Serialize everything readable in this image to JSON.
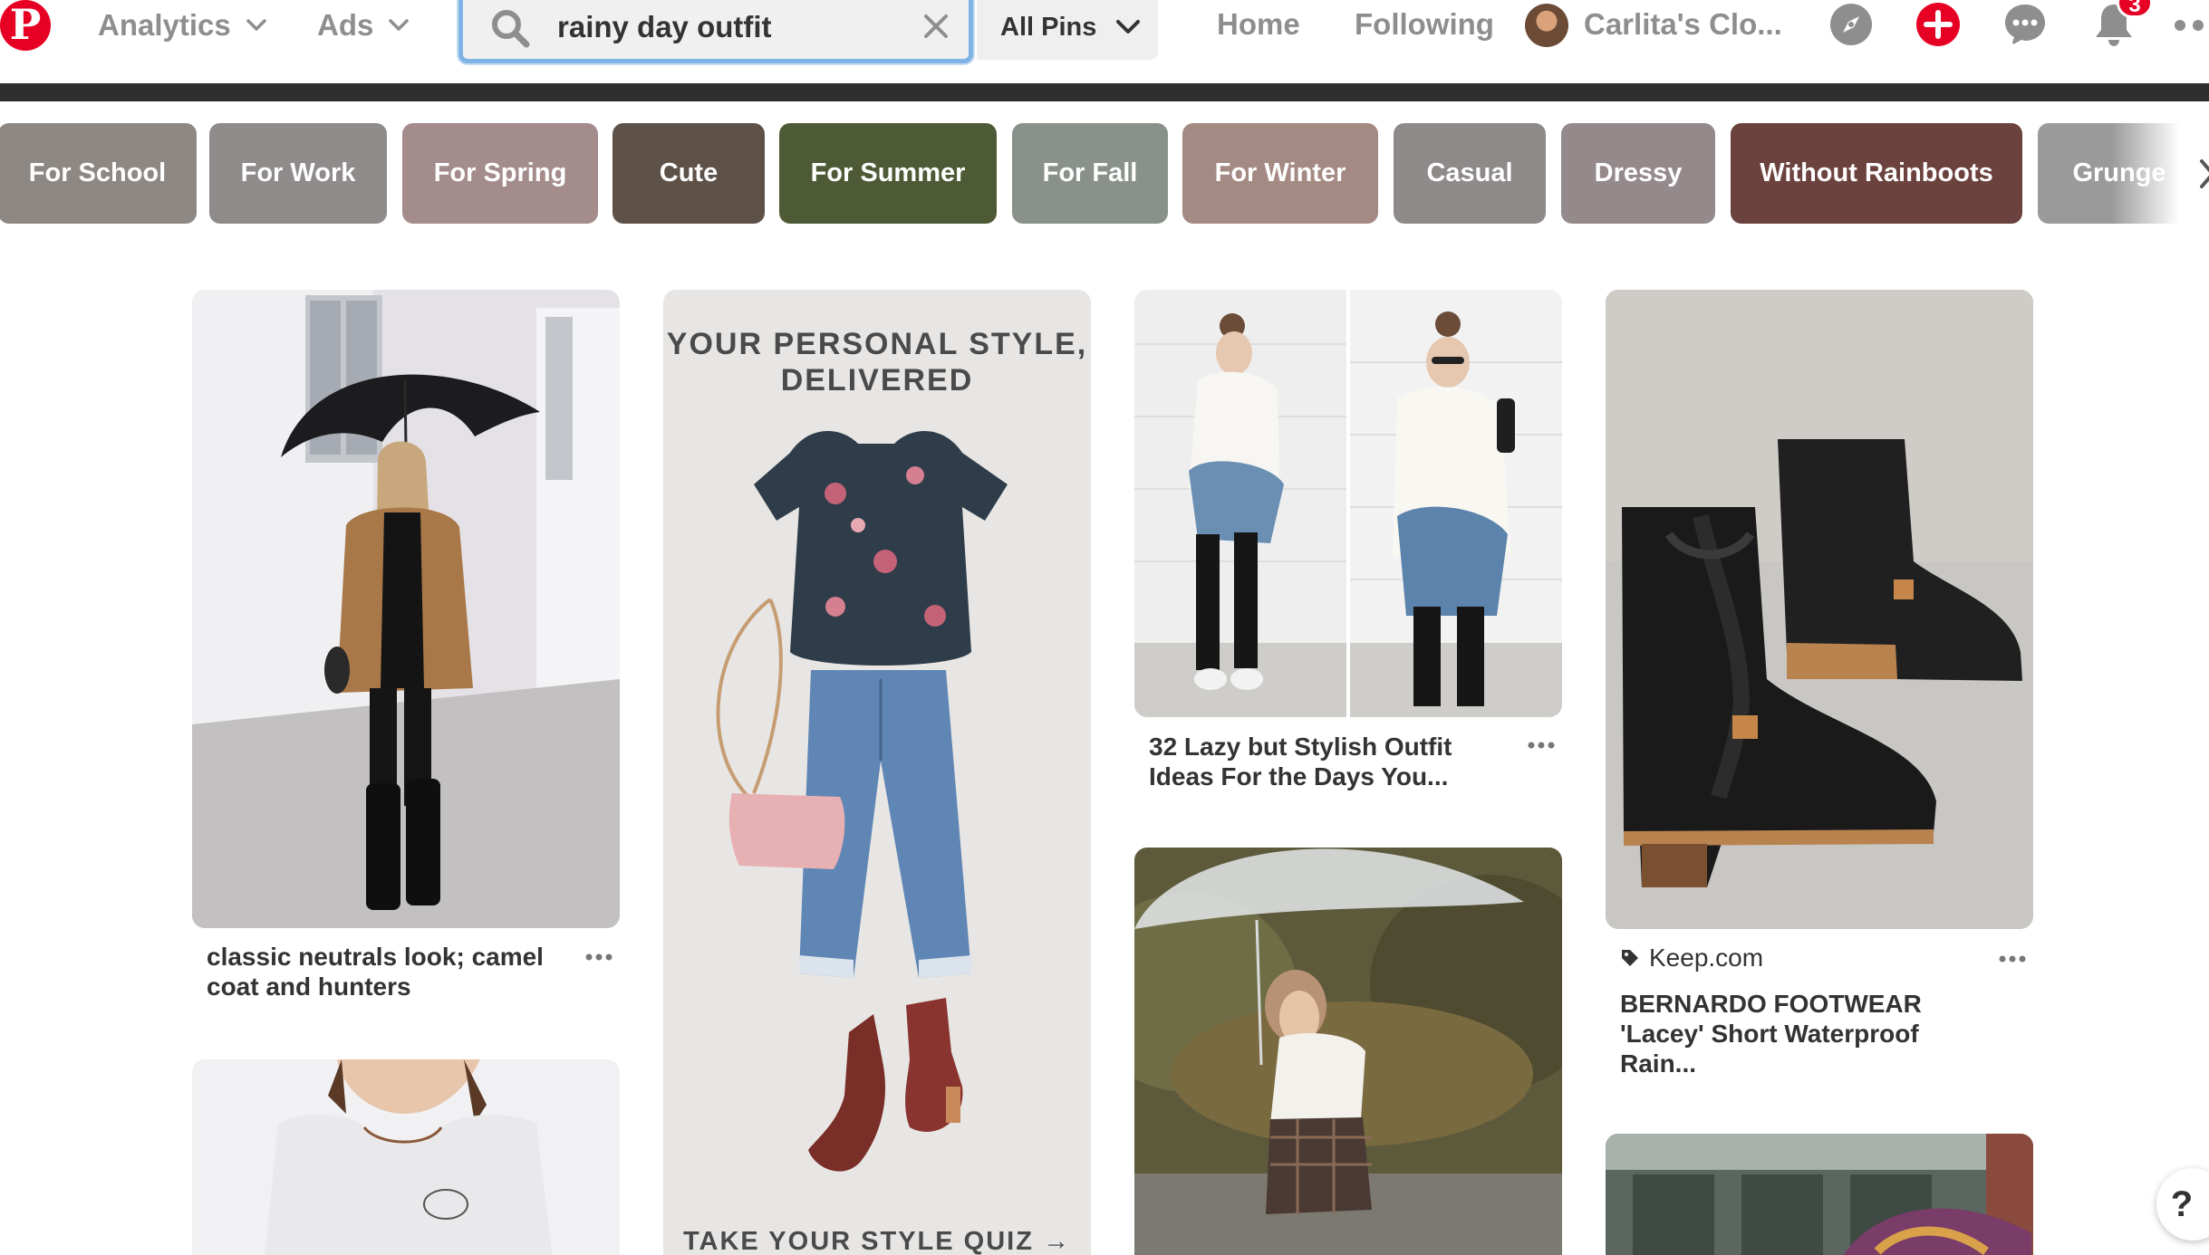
{
  "header": {
    "nav_analytics": "Analytics",
    "nav_ads": "Ads",
    "search": {
      "value": "rainy day outfit",
      "placeholder": "Search"
    },
    "scope": "All Pins",
    "home": "Home",
    "following": "Following",
    "profile_name": "Carlita's Clo...",
    "notification_count": "3",
    "help": "?"
  },
  "chips": [
    {
      "label": "For School",
      "color": "#8d8884"
    },
    {
      "label": "For Work",
      "color": "#8e8b8a"
    },
    {
      "label": "For Spring",
      "color": "#a58c8c"
    },
    {
      "label": "Cute",
      "color": "#5e5148"
    },
    {
      "label": "For Summer",
      "color": "#4d5a35"
    },
    {
      "label": "For Fall",
      "color": "#8a918a"
    },
    {
      "label": "For Winter",
      "color": "#a48a82"
    },
    {
      "label": "Casual",
      "color": "#8d8a89"
    },
    {
      "label": "Dressy",
      "color": "#958a8b"
    },
    {
      "label": "Without Rainboots",
      "color": "#6b423d"
    },
    {
      "label": "Grunge",
      "color": "#9a9a9a"
    }
  ],
  "pins": {
    "camel_coat": {
      "title_line1": "classic neutrals look; camel",
      "title_line2": "coat and hunters"
    },
    "ad": {
      "headline_line1": "YOUR PERSONAL STYLE,",
      "headline_line2": "DELIVERED",
      "cta": "TAKE YOUR STYLE QUIZ →"
    },
    "lazy_outfit": {
      "title_line1": "32 Lazy but Stylish Outfit",
      "title_line2": "Ideas For the Days You..."
    },
    "boots": {
      "source": "Keep.com",
      "title_line1": "BERNARDO FOOTWEAR",
      "title_line2": "'Lacey' Short Waterproof",
      "title_line3": "Rain..."
    }
  },
  "colors": {
    "brand_red": "#e60023",
    "search_focus": "#7fb3e6"
  }
}
